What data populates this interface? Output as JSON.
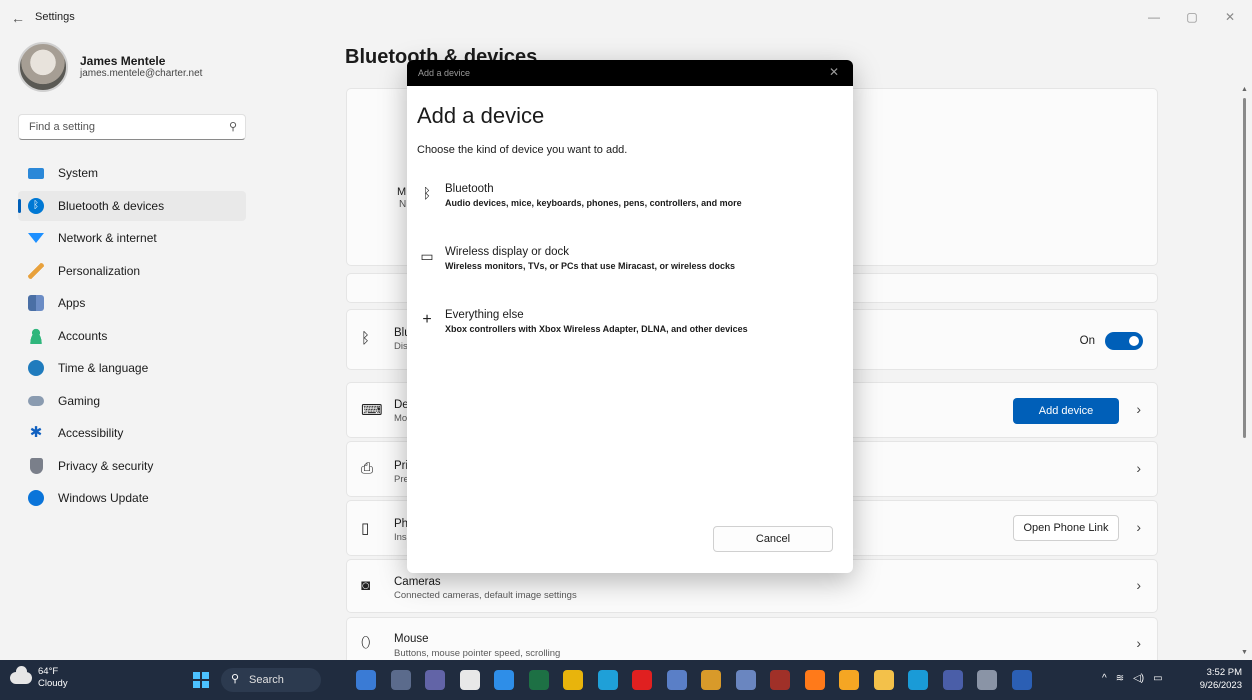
{
  "window": {
    "title": "Settings",
    "back_glyph": "←",
    "minimize": "—",
    "restore": "▢",
    "close": "✕"
  },
  "profile": {
    "name": "James Mentele",
    "email": "james.mentele@charter.net"
  },
  "search": {
    "placeholder": "Find a setting",
    "icon": "search-icon"
  },
  "nav": [
    {
      "label": "System",
      "icon": "system-icon",
      "color": "#2b88d8"
    },
    {
      "label": "Bluetooth & devices",
      "icon": "bluetooth-icon",
      "color": "#0078d4",
      "active": true
    },
    {
      "label": "Network & internet",
      "icon": "wifi-icon",
      "color": "#1e90ff"
    },
    {
      "label": "Personalization",
      "icon": "brush-icon",
      "color": "#e8a13c"
    },
    {
      "label": "Apps",
      "icon": "apps-icon",
      "color": "#4a6fa5"
    },
    {
      "label": "Accounts",
      "icon": "accounts-icon",
      "color": "#2fb67c"
    },
    {
      "label": "Time & language",
      "icon": "globe-icon",
      "color": "#1f7bbd"
    },
    {
      "label": "Gaming",
      "icon": "gamepad-icon",
      "color": "#8a9bb0"
    },
    {
      "label": "Accessibility",
      "icon": "accessibility-icon",
      "color": "#1060c0"
    },
    {
      "label": "Privacy & security",
      "icon": "shield-icon",
      "color": "#7a7f8a"
    },
    {
      "label": "Windows Update",
      "icon": "update-icon",
      "color": "#0a74d9"
    }
  ],
  "main": {
    "title": "Bluetooth & devices",
    "device_card": {
      "name_fragment": "M",
      "sub_fragment": "N"
    },
    "bluetooth_row": {
      "title_fragment": "Blu",
      "sub_fragment": "Dis",
      "toggle_label": "On"
    },
    "devices_row": {
      "title_fragment": "De",
      "sub_fragment": "Mo",
      "button": "Add device"
    },
    "printers_row": {
      "title_fragment": "Pri",
      "sub_fragment": "Pre"
    },
    "phone_row": {
      "title_fragment": "Ph",
      "sub_fragment": "Ins",
      "button": "Open Phone Link"
    },
    "cameras_row": {
      "title": "Cameras",
      "sub": "Connected cameras, default image settings"
    },
    "mouse_row": {
      "title": "Mouse",
      "sub": "Buttons, mouse pointer speed, scrolling"
    }
  },
  "modal": {
    "bar_title": "Add a device",
    "heading": "Add a device",
    "subtitle": "Choose the kind of device you want to add.",
    "options": [
      {
        "title": "Bluetooth",
        "desc": "Audio devices, mice, keyboards, phones, pens, controllers, and more",
        "icon": "bluetooth-icon"
      },
      {
        "title": "Wireless display or dock",
        "desc": "Wireless monitors, TVs, or PCs that use Miracast, or wireless docks",
        "icon": "monitor-icon"
      },
      {
        "title": "Everything else",
        "desc": "Xbox controllers with Xbox Wireless Adapter, DLNA, and other devices",
        "icon": "plus-icon"
      }
    ],
    "cancel": "Cancel"
  },
  "taskbar": {
    "weather_temp": "64°F",
    "weather_cond": "Cloudy",
    "search_label": "Search",
    "time": "3:52 PM",
    "date": "9/26/2023",
    "apps": [
      {
        "name": "app-icon-1",
        "color": "#3a7bd5"
      },
      {
        "name": "app-icon-2",
        "color": "#5b6b8c"
      },
      {
        "name": "app-icon-3",
        "color": "#6264a7"
      },
      {
        "name": "app-icon-4",
        "color": "#e8e8e8"
      },
      {
        "name": "app-icon-5",
        "color": "#2e8ee8"
      },
      {
        "name": "excel-icon",
        "color": "#1d7044"
      },
      {
        "name": "chrome-icon",
        "color": "#e8b40c"
      },
      {
        "name": "edge-icon",
        "color": "#1fa0d8"
      },
      {
        "name": "youtube-icon",
        "color": "#e02020"
      },
      {
        "name": "app-icon-10",
        "color": "#5a7fc7"
      },
      {
        "name": "app-icon-11",
        "color": "#d89a2a"
      },
      {
        "name": "app-icon-12",
        "color": "#6a86c0"
      },
      {
        "name": "app-icon-13",
        "color": "#a03028"
      },
      {
        "name": "firefox-icon",
        "color": "#ff7a1a"
      },
      {
        "name": "app-icon-15",
        "color": "#f5a623"
      },
      {
        "name": "file-explorer-icon",
        "color": "#f3c14a"
      },
      {
        "name": "bing-icon",
        "color": "#1a9bd7"
      },
      {
        "name": "app-icon-18",
        "color": "#4a5ea8"
      },
      {
        "name": "settings-icon",
        "color": "#8a94a6"
      },
      {
        "name": "word-icon",
        "color": "#2b5fb4"
      }
    ]
  }
}
